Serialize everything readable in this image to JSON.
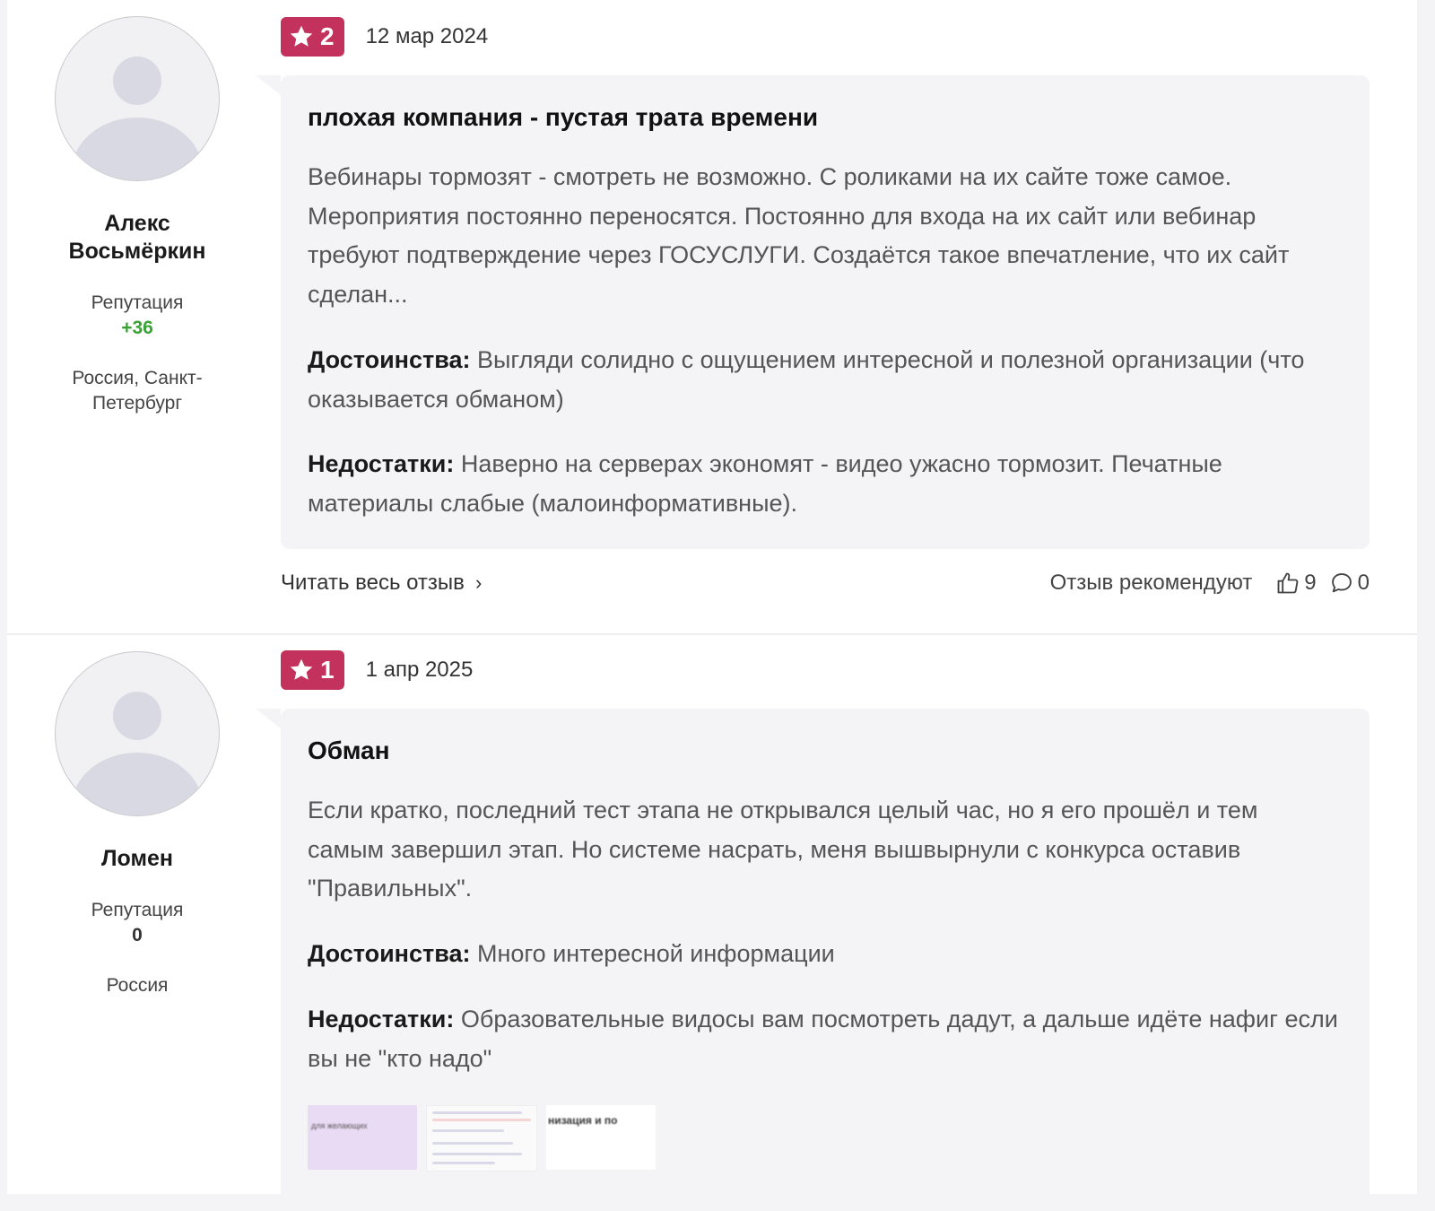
{
  "reviews": [
    {
      "author": {
        "name": "Алекс Восьмёркин",
        "reputation_label": "Репутация",
        "reputation": "+36",
        "location": "Россия, Санкт-Петербург"
      },
      "rating": "2",
      "date": "12 мар 2024",
      "title": "плохая компания - пустая трата времени",
      "text": "Вебинары тормозят - смотреть не возможно. С роликами на их сайте тоже самое. Мероприятия постоянно переносятся. Постоянно для входа на их сайт или вебинар требуют подтверждение через ГОСУСЛУГИ. Создаётся такое впечатление, что их сайт сделан...",
      "pros_label": "Достоинства:",
      "pros": "Выгляди солидно с ощущением интересной и полезной организации (что оказывается обманом)",
      "cons_label": "Недостатки:",
      "cons": "Наверно на серверах экономят - видео ужасно тормозит. Печатные материалы слабые (малоинформативные).",
      "read_more": "Читать весь отзыв",
      "recommend_label": "Отзыв рекомендуют",
      "likes": "9",
      "comments": "0"
    },
    {
      "author": {
        "name": "Ломен",
        "reputation_label": "Репутация",
        "reputation": "0",
        "location": "Россия"
      },
      "rating": "1",
      "date": "1 апр 2025",
      "title": "Обман",
      "text": "Если кратко, последний тест этапа не открывался целый час, но я его прошёл и тем самым завершил этап. Но системе насрать, меня вышвырнули с конкурса оставив \"Правильных\".",
      "pros_label": "Достоинства:",
      "pros": "Много интересной информации",
      "cons_label": "Недостатки:",
      "cons": "Образовательные видосы вам посмотреть дадут, а дальше идёте нафиг если вы не \"кто надо\"",
      "attachments": [
        {
          "caption": "для желающих"
        },
        {
          "caption": ""
        },
        {
          "caption": "низация и по"
        }
      ]
    }
  ],
  "colors": {
    "badge": "#c2325c",
    "reputation_positive": "#3aa335",
    "bubble": "#f4f4f6"
  },
  "icons": {
    "rating": "star-icon",
    "like": "thumbs-up-icon",
    "comment": "comment-icon",
    "more": "chevron-right-icon"
  }
}
